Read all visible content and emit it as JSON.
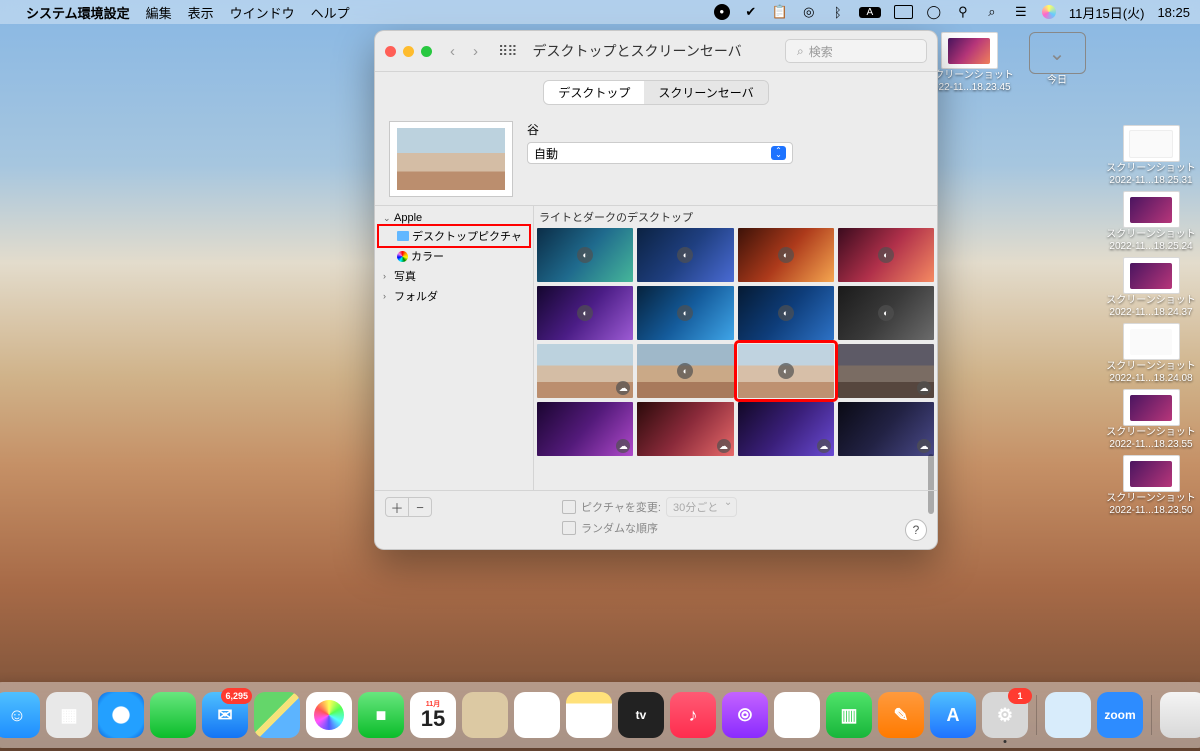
{
  "menubar": {
    "app": "システム環境設定",
    "items": [
      "編集",
      "表示",
      "ウインドウ",
      "ヘルプ"
    ],
    "date": "11月15日(火)",
    "time": "18:25"
  },
  "window": {
    "title": "デスクトップとスクリーンセーバ",
    "search_placeholder": "検索",
    "tabs": {
      "desktop": "デスクトップ",
      "screensaver": "スクリーンセーバ"
    },
    "wp_name": "谷",
    "dropdown_value": "自動",
    "sidebar": {
      "apple": "Apple",
      "desktop_pic": "デスクトップピクチャ",
      "colors": "カラー",
      "photos": "写真",
      "folders": "フォルダ"
    },
    "section_header": "ライトとダークのデスクトップ",
    "footer": {
      "change_pic": "ピクチャを変更:",
      "interval": "30分ごと",
      "random": "ランダムな順序"
    }
  },
  "desktop_icons": {
    "today": "今日",
    "items": [
      {
        "name1": "スクリーンショット",
        "name2": "2022-11...18.23.45"
      },
      {
        "name1": "スクリーンショット",
        "name2": "2022-11...18.25.31"
      },
      {
        "name1": "スクリーンショット",
        "name2": "2022-11...18.25.24"
      },
      {
        "name1": "スクリーンショット",
        "name2": "2022-11...18.24.37"
      },
      {
        "name1": "スクリーンショット",
        "name2": "2022-11...18.24.08"
      },
      {
        "name1": "スクリーンショット",
        "name2": "2022-11...18.23.55"
      },
      {
        "name1": "スクリーンショット",
        "name2": "2022-11...18.23.50"
      }
    ]
  },
  "dock": {
    "mail_badge": "6,295",
    "cal_month": "11月",
    "cal_day": "15",
    "sys_badge": "1",
    "apps": [
      {
        "name": "finder",
        "bg": "linear-gradient(#4fc0ff,#1e8eff)"
      },
      {
        "name": "launchpad",
        "bg": "#e8e8e8"
      },
      {
        "name": "safari",
        "bg": "radial-gradient(circle,#fff 25%,#23a0ff 28% 70%,#0a5ad4 100%)"
      },
      {
        "name": "messages",
        "bg": "linear-gradient(#67e67e,#0bbd2a)"
      },
      {
        "name": "mail",
        "bg": "linear-gradient(#4fc0ff,#1374f4)"
      },
      {
        "name": "maps",
        "bg": "linear-gradient(135deg,#64d66a 0 45%,#f6e27a 45% 55%,#5cb4ff 55%)"
      },
      {
        "name": "photos",
        "bg": "#fff"
      },
      {
        "name": "facetime",
        "bg": "linear-gradient(#67e67e,#0bbd2a)"
      },
      {
        "name": "calendar",
        "bg": "#fff"
      },
      {
        "name": "contacts",
        "bg": "#dcc9a3"
      },
      {
        "name": "reminders",
        "bg": "#fff"
      },
      {
        "name": "notes",
        "bg": "linear-gradient(#ffe17a 0 25%,#fff 25%)"
      },
      {
        "name": "appletv",
        "bg": "#222"
      },
      {
        "name": "music",
        "bg": "linear-gradient(#ff5a74,#ff2d4e)"
      },
      {
        "name": "podcasts",
        "bg": "linear-gradient(#c463ff,#8a2bff)"
      },
      {
        "name": "news",
        "bg": "#fff"
      },
      {
        "name": "numbers",
        "bg": "linear-gradient(#4fe36a,#18b63a)"
      },
      {
        "name": "keynote",
        "bg": "linear-gradient(#ff9a3d,#ff7a00)"
      },
      {
        "name": "appstore",
        "bg": "linear-gradient(#4fc0ff,#1e73ff)"
      },
      {
        "name": "settings",
        "bg": "#d7d7d7"
      }
    ],
    "right_apps": [
      {
        "name": "preview",
        "bg": "#d8ecfb"
      },
      {
        "name": "zoom",
        "bg": "#2d8cff"
      }
    ]
  },
  "wallpapers": [
    {
      "bg": "linear-gradient(130deg,#0b2d47,#1f6a8d,#46b79a)"
    },
    {
      "bg": "linear-gradient(130deg,#0b2242,#1f3f80,#4a6bd4)"
    },
    {
      "bg": "linear-gradient(130deg,#3d1208,#ad3a1b,#f5a650)"
    },
    {
      "bg": "linear-gradient(130deg,#3b0b1e,#b0304a,#f58a62)"
    },
    {
      "bg": "linear-gradient(130deg,#14062e,#4b1d86,#9d5bd4)"
    },
    {
      "bg": "linear-gradient(130deg,#06223d,#145b9b,#3fa5e8)"
    },
    {
      "bg": "linear-gradient(130deg,#051a33,#0e3d7a,#2d72c6)"
    },
    {
      "bg": "linear-gradient(130deg,#1a1a1a,#3a3a3a,#6b6b6b)"
    },
    {
      "bg": "linear-gradient(#bcd2de 0 40%,#d4bda5 40% 70%,#bb8e6e 70%)",
      "dl": true
    },
    {
      "bg": "linear-gradient(#9fb8c9 0 40%,#caa987 40% 70%,#a87a5c 70%)"
    },
    {
      "bg": "linear-gradient(#c0d3e0 0 40%,#d7bfa8 40% 70%,#be9171 70%)",
      "sel": true
    },
    {
      "bg": "linear-gradient(#5d5a66 0 40%,#7a6c63 40% 70%,#56463e 70%)",
      "dl": true
    },
    {
      "bg": "linear-gradient(130deg,#1a0530,#531a7a,#b04acb)",
      "dl": true
    },
    {
      "bg": "linear-gradient(130deg,#2b0a0a,#8a2a3a,#e86a6a)",
      "dl": true
    },
    {
      "bg": "linear-gradient(130deg,#120826,#3a1f7a,#6a4bd4)",
      "dl": true
    },
    {
      "bg": "linear-gradient(130deg,#0a0a14,#222244,#4a4a8a)",
      "dl": true
    }
  ]
}
